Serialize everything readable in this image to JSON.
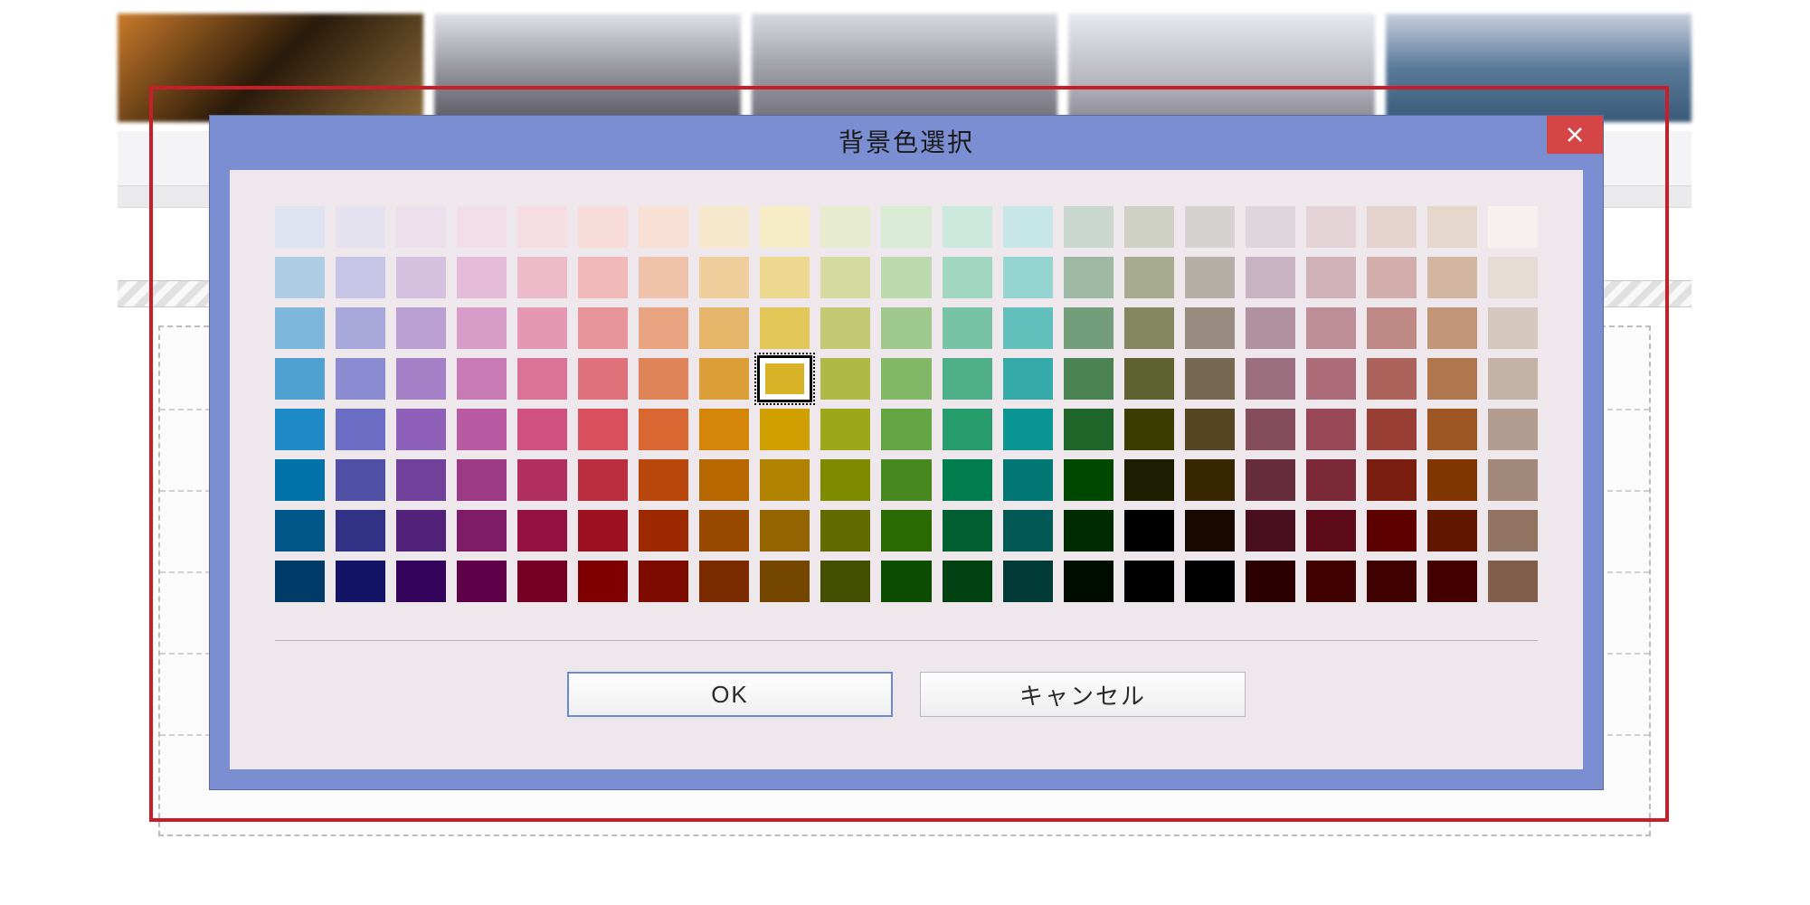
{
  "dialog": {
    "title": "背景色選択",
    "ok_label": "OK",
    "cancel_label": "キャンセル",
    "close_label": "×"
  },
  "selected_swatch": {
    "row": 3,
    "col": 8
  },
  "palette_rows": [
    [
      "#dde4ef",
      "#e4e2ef",
      "#ece0ed",
      "#f2dee9",
      "#f6dde3",
      "#f8dcdb",
      "#f8e1d4",
      "#f7e7cc",
      "#f6edc7",
      "#e8ecce",
      "#daebd5",
      "#cde9dd",
      "#c6e7e5",
      "#c9d7ce",
      "#cdd0c3",
      "#d6d2cf",
      "#dfd5dc",
      "#e4d4d7",
      "#e4d2cf",
      "#e5d7cb",
      "#f6f1ee"
    ],
    [
      "#aecde5",
      "#c6c5e5",
      "#d5c0e0",
      "#e4bcd7",
      "#ecbac9",
      "#f0b9b8",
      "#f0c2aa",
      "#eece9a",
      "#ecd98f",
      "#d5dba0",
      "#bcdab0",
      "#a1d7c1",
      "#94d4d1",
      "#9ebaa4",
      "#a6ab90",
      "#b6afa7",
      "#c8b3c2",
      "#d1b1b8",
      "#d1adab",
      "#d3b6a1",
      "#e5dcd6"
    ],
    [
      "#7eb7db",
      "#a8a8da",
      "#bda0d3",
      "#d69bc6",
      "#e397b0",
      "#e8959a",
      "#e8a481",
      "#e5b669",
      "#e2c658",
      "#c2ca73",
      "#9fc88c",
      "#78c3a5",
      "#63bfbc",
      "#749e7b",
      "#82875f",
      "#978c7f",
      "#b2919f",
      "#be8e98",
      "#be8885",
      "#c19677",
      "#d4c7be"
    ],
    [
      "#4ea1d1",
      "#8a8bd0",
      "#a580c6",
      "#c87ab4",
      "#d97497",
      "#e0727c",
      "#e08559",
      "#dc9e38",
      "#d8b328",
      "#afb946",
      "#82b768",
      "#4faf89",
      "#35aaa8",
      "#4a8252",
      "#5e622f",
      "#776951",
      "#9b6f7e",
      "#ac6b79",
      "#ac635c",
      "#b0764e",
      "#c4b2a7"
    ],
    [
      "#1e8bc8",
      "#6c6ec5",
      "#8e60b9",
      "#ba5aa3",
      "#d0517e",
      "#d8505e",
      "#d86731",
      "#d4860a",
      "#cfa000",
      "#9ca81a",
      "#65a644",
      "#269b6c",
      "#0a9593",
      "#20662a",
      "#3a3d00",
      "#574623",
      "#854d5c",
      "#994857",
      "#993e34",
      "#9e5625",
      "#b39d90"
    ],
    [
      "#0072a8",
      "#4f50a5",
      "#70409a",
      "#9c3a85",
      "#b23060",
      "#ba2e3f",
      "#ba470c",
      "#b66700",
      "#b18200",
      "#7e8a00",
      "#488820",
      "#007d4e",
      "#007773",
      "#004800",
      "#1c1e00",
      "#372600",
      "#672d3c",
      "#7b2837",
      "#7b1e12",
      "#803600",
      "#a28879"
    ],
    [
      "#005688",
      "#313285",
      "#52227b",
      "#7e1c67",
      "#941242",
      "#9c1021",
      "#9c2900",
      "#984900",
      "#936400",
      "#606c00",
      "#2a6a02",
      "#005f30",
      "#005955",
      "#002a00",
      "#000000",
      "#190800",
      "#490f1e",
      "#5d0a19",
      "#5d0000",
      "#621800",
      "#917362"
    ],
    [
      "#003a68",
      "#131466",
      "#34045c",
      "#600048",
      "#760023",
      "#7e0003",
      "#7e0b00",
      "#7a2b00",
      "#754600",
      "#424e00",
      "#0c4c00",
      "#004112",
      "#003b37",
      "#000c00",
      "#000000",
      "#000000",
      "#2b0000",
      "#3f0000",
      "#3f0000",
      "#440000",
      "#805e4b"
    ]
  ]
}
